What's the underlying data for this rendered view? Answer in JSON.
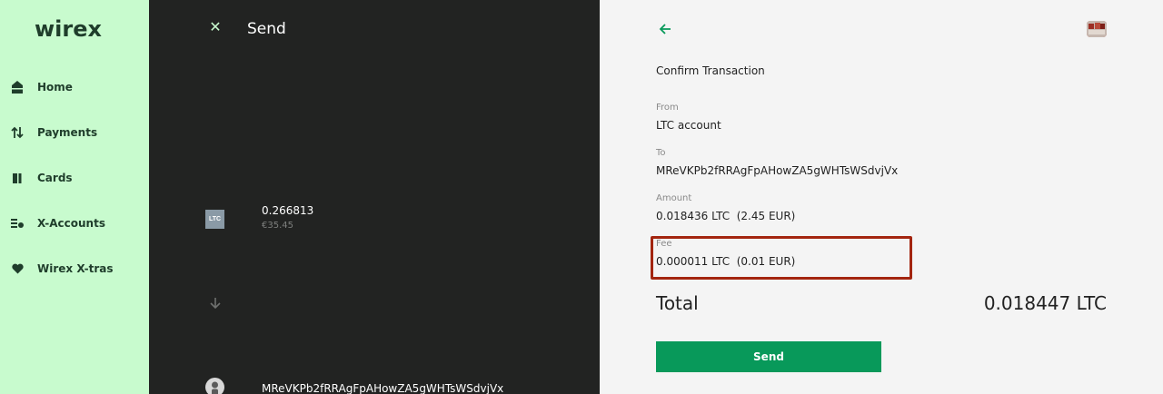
{
  "brand": {
    "logo_text": "wirex",
    "accent_color": "#08995a",
    "sidebar_bg": "#c8fbce",
    "dark_bg": "#222322",
    "highlight_color": "#a3250f"
  },
  "sidebar": {
    "items": [
      {
        "label": "Home",
        "icon": "home-icon"
      },
      {
        "label": "Payments",
        "icon": "transfer-arrows-icon"
      },
      {
        "label": "Cards",
        "icon": "cards-icon"
      },
      {
        "label": "X-Accounts",
        "icon": "accounts-icon"
      },
      {
        "label": "Wirex X-tras",
        "icon": "heart-icon"
      }
    ]
  },
  "send_panel": {
    "title": "Send",
    "close_icon": "close-icon",
    "source": {
      "badge": "LTC",
      "amount": "0.266813",
      "fiat": "€35.45"
    },
    "direction_icon": "arrow-down-icon",
    "recipient": {
      "icon": "person-icon",
      "address": "MReVKPb2fRRAgFpAHowZA5gWHTsWSdvjVx"
    }
  },
  "confirm": {
    "back_icon": "arrow-left-icon",
    "avatar_icon": "avatar",
    "title": "Confirm Transaction",
    "from_label": "From",
    "from_value": "LTC account",
    "to_label": "To",
    "to_value": "MReVKPb2fRRAgFpAHowZA5gWHTsWSdvjVx",
    "amount_label": "Amount",
    "amount_value": "0.018436 LTC  (2.45 EUR)",
    "fee_label": "Fee",
    "fee_value": "0.000011 LTC  (0.01 EUR)",
    "total_label": "Total",
    "total_value": "0.018447 LTC",
    "send_button": "Send"
  }
}
